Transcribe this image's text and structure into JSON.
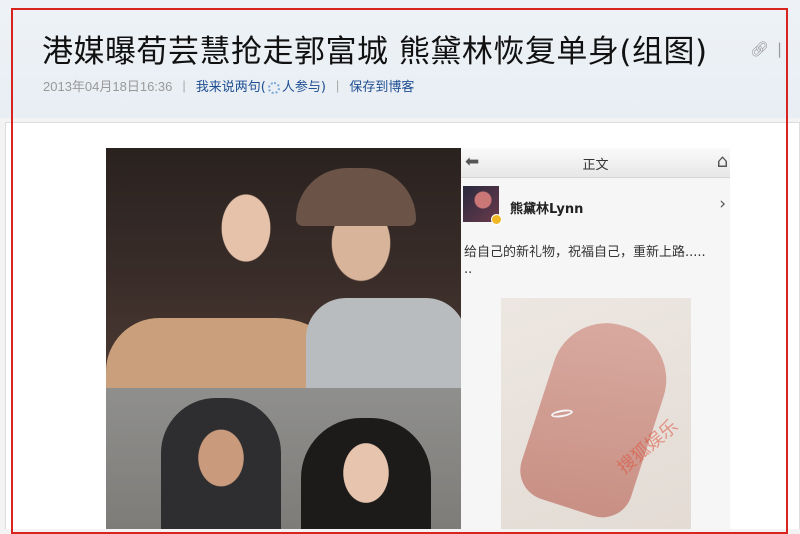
{
  "article": {
    "title": "港媒曝荀芸慧抢走郭富城 熊黛林恢复单身(组图)",
    "date": "2013年04月18日16:36",
    "comment_prefix": "我来说两句(",
    "comment_suffix": "人参与)",
    "save_blog": "保存到博客",
    "separator": "|"
  },
  "header_icons": [
    "link-icon",
    "more-icon"
  ],
  "phone": {
    "bar_title": "正文",
    "profile_name": "熊黛林Lynn",
    "post_text": "给自己的新礼物，祝福自己，重新上路.....",
    "post_text_cont": "..",
    "watermark": "搜狐娱乐"
  },
  "colors": {
    "frame": "#d8231f",
    "link": "#1f4e92",
    "header_bg": "#eef2f6"
  }
}
